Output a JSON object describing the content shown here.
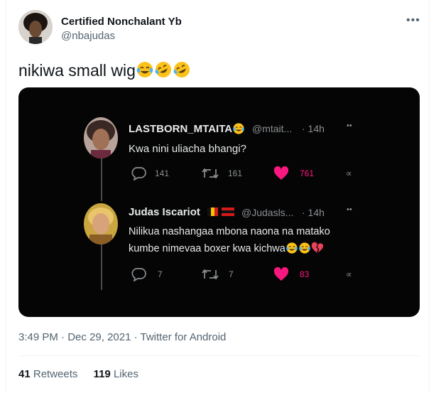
{
  "author": {
    "name": "Certified Nonchalant Yb",
    "handle": "@nbajudas"
  },
  "tweet": {
    "text": "nikiwa small wig"
  },
  "media": {
    "replies": [
      {
        "name": "LASTBORN_MTAITA",
        "handle": "@mtait...",
        "time": "· 14h",
        "text": "Kwa nini uliacha bhangi?",
        "reply_count": "141",
        "retweet_count": "161",
        "like_count": "761"
      },
      {
        "name": "Judas Iscariot",
        "handle": "@Judasls...",
        "time": "· 14h",
        "text_line1": "Nilikua nashangaa mbona naona na matako",
        "text_line2": "kumbe nimevaa boxer kwa kichwa",
        "reply_count": "7",
        "retweet_count": "7",
        "like_count": "83"
      }
    ]
  },
  "meta": {
    "time": "3:49 PM",
    "sep1": " · ",
    "date": "Dec 29, 2021",
    "sep2": " · ",
    "source": "Twitter for Android"
  },
  "stats": {
    "retweets_count": "41",
    "retweets_label": "Retweets",
    "likes_count": "119",
    "likes_label": "Likes"
  },
  "icons": [
    "more-icon",
    "reply-icon",
    "retweet-icon",
    "heart-icon",
    "share-icon",
    "laugh-emoji",
    "rofl-emoji",
    "broken-heart-emoji"
  ],
  "colors": {
    "accent": "#1d9bf0",
    "like": "#f91880",
    "text_secondary": "#536471",
    "media_bg": "#050505"
  }
}
